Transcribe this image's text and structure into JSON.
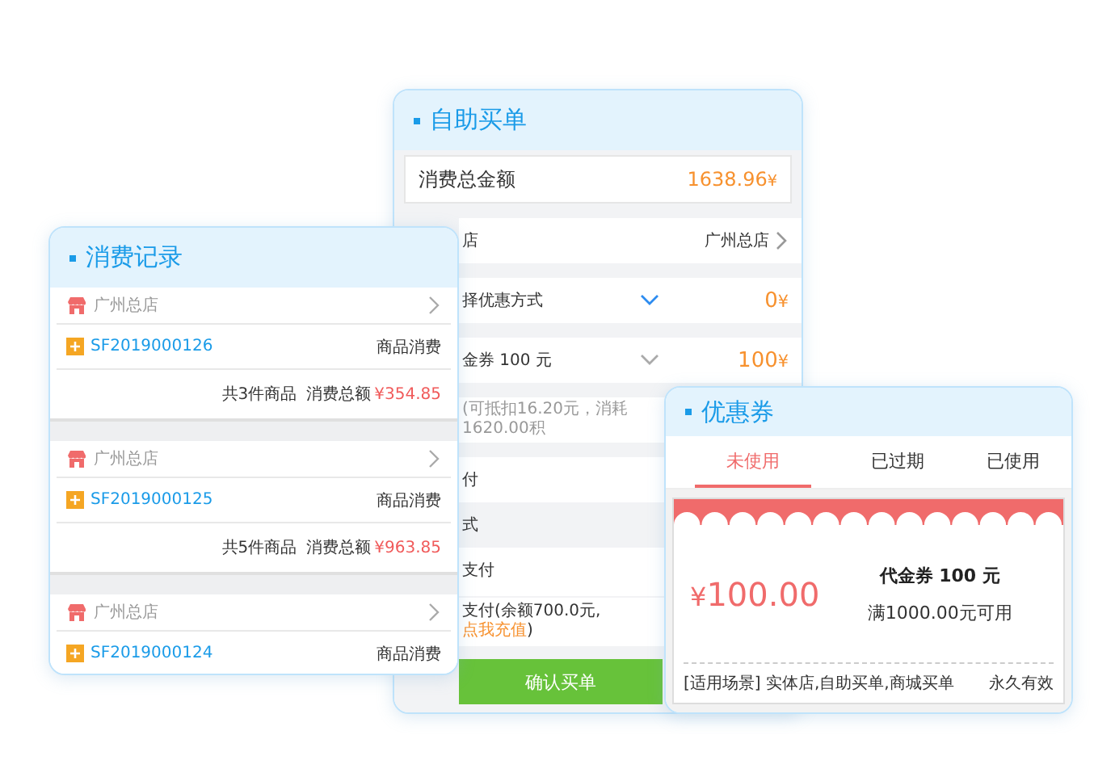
{
  "self_checkout": {
    "title": "自助买单",
    "total": {
      "label": "消费总金额",
      "amount": "1638.96",
      "currency": "¥"
    },
    "rows": [
      {
        "kind": "link",
        "label": "店",
        "value": "广州总店"
      },
      {
        "kind": "select",
        "label": "择优惠方式",
        "value": "0",
        "currency": "¥",
        "focused": true
      },
      {
        "kind": "select",
        "label": "金券 100 元",
        "value": "100",
        "currency": "¥",
        "focused": false
      },
      {
        "kind": "note",
        "label": "(可抵扣16.20元，消耗1620.00积"
      },
      {
        "kind": "plain",
        "label": "付"
      },
      {
        "kind": "section",
        "label": "式"
      },
      {
        "kind": "option",
        "label": "支付"
      },
      {
        "kind": "option",
        "label": "支付(余额700.0元,",
        "link": "点我充值",
        "label_end": ")"
      }
    ],
    "confirm_button": "确认买单"
  },
  "records": {
    "title": "消费记录",
    "items": [
      {
        "store": "广州总店",
        "order_no": "SF2019000126",
        "type": "商品消费",
        "count": "共3件商品",
        "total_label": "消费总额",
        "amount": "¥354.85"
      },
      {
        "store": "广州总店",
        "order_no": "SF2019000125",
        "type": "商品消费",
        "count": "共5件商品",
        "total_label": "消费总额",
        "amount": "¥963.85"
      },
      {
        "store": "广州总店",
        "order_no": "SF2019000124",
        "type": "商品消费"
      }
    ]
  },
  "coupons": {
    "title": "优惠券",
    "tabs": [
      {
        "label": "未使用",
        "selected": true
      },
      {
        "label": "已过期",
        "selected": false
      },
      {
        "label": "已使用",
        "selected": false
      }
    ],
    "coupon": {
      "currency": "¥",
      "amount": "100.00",
      "name": "代金券 100 元",
      "condition": "满1000.00元可用",
      "scope": "[适用场景] 实体店,自助买单,商城买单",
      "validity": "永久有效"
    }
  }
}
